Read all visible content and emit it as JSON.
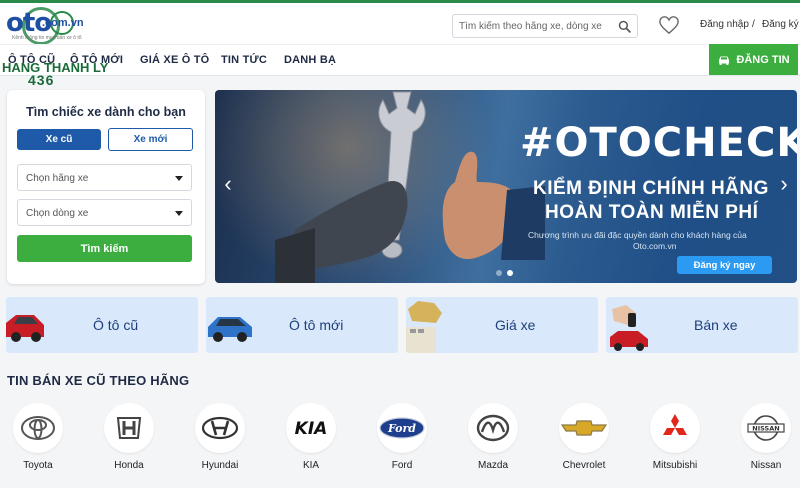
{
  "header": {
    "logo_text": "oto",
    "logo_domain": ".com.vn",
    "logo_tagline": "Kênh thông tin mua bán xe ô tô",
    "watermark_line1": "HANG THANH LY",
    "watermark_line2": "436",
    "search_placeholder": "Tìm kiếm theo hãng xe, dòng xe",
    "login_label": "Đăng nhập",
    "separator": "/",
    "register_label": "Đăng ký"
  },
  "nav": {
    "items": [
      "Ô TÔ CŨ",
      "Ô TÔ MỚI",
      "GIÁ XE Ô TÔ",
      "TIN TỨC",
      "DANH BẠ"
    ],
    "post_button": "ĐĂNG TIN"
  },
  "search_panel": {
    "title": "Tìm chiếc xe dành cho bạn",
    "tab_used": "Xe cũ",
    "tab_new": "Xe mới",
    "brand_select": "Chọn hãng xe",
    "model_select": "Chọn dòng xe",
    "search_button": "Tìm kiếm"
  },
  "banner": {
    "hashtag": "#OTOCHECK",
    "line1": "KIỂM ĐỊNH CHÍNH HÃNG",
    "line2": "HOÀN TOÀN MIỄN PHÍ",
    "sub1": "Chương trình ưu đãi đặc quyền dành cho khách hàng của",
    "sub2": "Oto.com.vn",
    "cta": "Đăng ký ngay",
    "prev_arrow": "‹",
    "next_arrow": "›",
    "active_slide": 2,
    "slide_count": 2
  },
  "categories": [
    "Ô tô cũ",
    "Ô tô mới",
    "Giá xe",
    "Bán xe"
  ],
  "brands_section": {
    "title": "TIN BÁN XE CŨ THEO HÃNG",
    "brands": [
      "Toyota",
      "Honda",
      "Hyundai",
      "KIA",
      "Ford",
      "Mazda",
      "Chevrolet",
      "Mitsubishi",
      "Nissan"
    ],
    "logo_texts": {
      "kia": "KIA",
      "ford": "Ford",
      "nissan": "NISSAN"
    }
  },
  "colors": {
    "brand_green": "#3cad3f",
    "brand_blue": "#1f5aa8",
    "card_blue": "#d9e9fb",
    "cta_blue": "#2b9af3"
  }
}
